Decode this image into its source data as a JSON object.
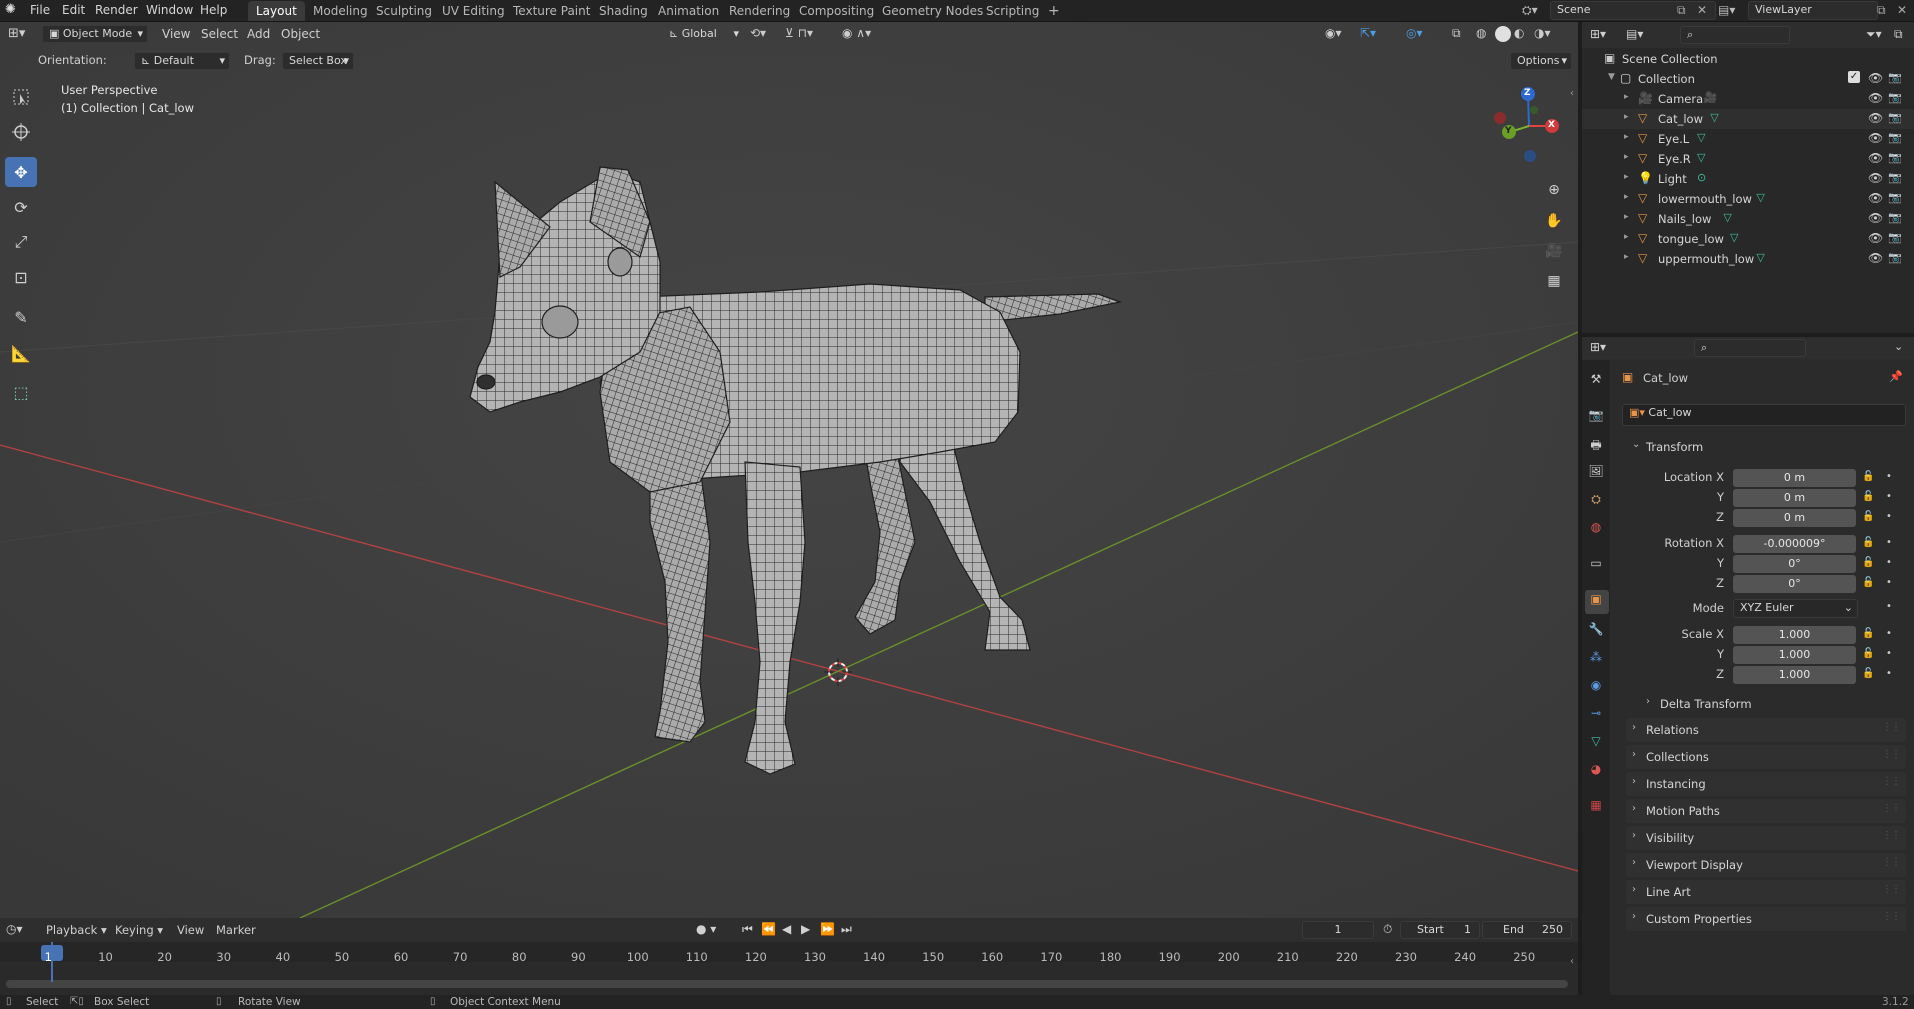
{
  "topbar": {
    "menu": [
      "File",
      "Edit",
      "Render",
      "Window",
      "Help"
    ],
    "workspaces": [
      "Layout",
      "Modeling",
      "Sculpting",
      "UV Editing",
      "Texture Paint",
      "Shading",
      "Animation",
      "Rendering",
      "Compositing",
      "Geometry Nodes",
      "Scripting"
    ],
    "active_workspace": "Layout",
    "add_tab": "+",
    "scene_label": "Scene",
    "viewlayer_label": "ViewLayer"
  },
  "viewport": {
    "mode": "Object Mode",
    "menus": [
      "View",
      "Select",
      "Add",
      "Object"
    ],
    "transform_orientation": "Global",
    "orientation_label": "Orientation:",
    "orientation_value": "Default",
    "drag_label": "Drag:",
    "drag_value": "Select Box",
    "options_label": "Options",
    "overlay_title": "User Perspective",
    "overlay_subtitle": "(1) Collection | Cat_low",
    "gizmo_z": "Z",
    "gizmo_y": "Y",
    "gizmo_x": "X"
  },
  "outliner": {
    "root": "Scene Collection",
    "collection": "Collection",
    "items": [
      {
        "name": "Camera",
        "icon": "camera-icon"
      },
      {
        "name": "Cat_low",
        "icon": "mesh-icon"
      },
      {
        "name": "Eye.L",
        "icon": "mesh-icon"
      },
      {
        "name": "Eye.R",
        "icon": "mesh-icon"
      },
      {
        "name": "Light",
        "icon": "light-icon"
      },
      {
        "name": "lowermouth_low",
        "icon": "mesh-icon"
      },
      {
        "name": "Nails_low",
        "icon": "mesh-icon"
      },
      {
        "name": "tongue_low",
        "icon": "mesh-icon"
      },
      {
        "name": "uppermouth_low",
        "icon": "mesh-icon"
      }
    ]
  },
  "properties": {
    "object_name": "Cat_low",
    "datablock_name": "Cat_low",
    "transform_title": "Transform",
    "location_label": "Location X",
    "location": [
      "0 m",
      "0 m",
      "0 m"
    ],
    "rotation_label": "Rotation X",
    "rotation": [
      "-0.000009°",
      "0°",
      "0°"
    ],
    "axis_y": "Y",
    "axis_z": "Z",
    "mode_label": "Mode",
    "mode_value": "XYZ Euler",
    "scale_label": "Scale X",
    "scale": [
      "1.000",
      "1.000",
      "1.000"
    ],
    "delta_transform": "Delta Transform",
    "panels": [
      "Relations",
      "Collections",
      "Instancing",
      "Motion Paths",
      "Visibility",
      "Viewport Display",
      "Line Art",
      "Custom Properties"
    ]
  },
  "timeline": {
    "menus": [
      "Playback",
      "Keying",
      "View",
      "Marker"
    ],
    "current_frame": "1",
    "start_label": "Start",
    "start_value": "1",
    "end_label": "End",
    "end_value": "250",
    "ruler": [
      "1",
      "10",
      "20",
      "30",
      "40",
      "50",
      "60",
      "70",
      "80",
      "90",
      "100",
      "110",
      "120",
      "130",
      "140",
      "150",
      "160",
      "170",
      "180",
      "190",
      "200",
      "210",
      "220",
      "230",
      "240",
      "250"
    ]
  },
  "statusbar": {
    "select": "Select",
    "box_select": "Box Select",
    "rotate_view": "Rotate View",
    "context_menu": "Object Context Menu",
    "version": "3.1.2"
  },
  "colors": {
    "accent": "#4772b3",
    "x_axis": "#c94a4a",
    "y_axis": "#6f9a2c",
    "mesh_orange": "#e8954a",
    "mesh_data_green": "#3dbd9c"
  }
}
